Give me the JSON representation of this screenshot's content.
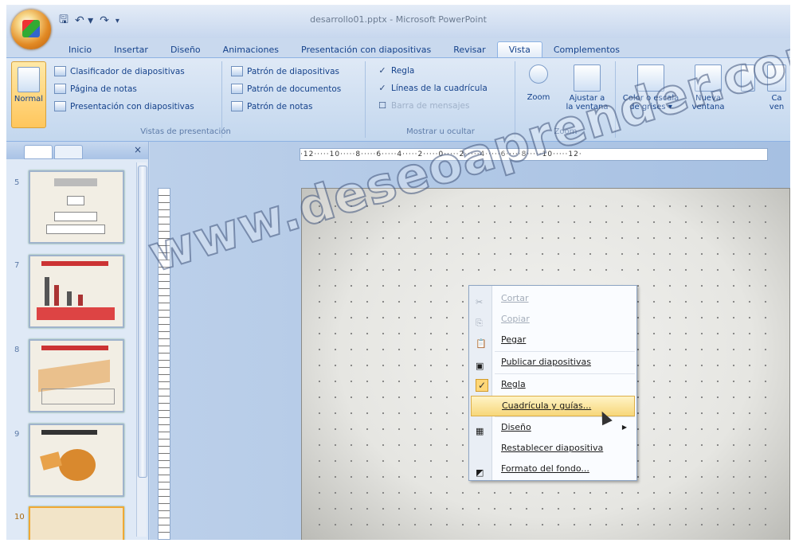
{
  "window": {
    "title": "desarrollo01.pptx - Microsoft PowerPoint"
  },
  "tabs": [
    "Inicio",
    "Insertar",
    "Diseño",
    "Animaciones",
    "Presentación con diapositivas",
    "Revisar",
    "Vista",
    "Complementos"
  ],
  "active_tab": "Vista",
  "ribbon": {
    "group1": {
      "normal": "Normal",
      "items": [
        "Clasificador de diapositivas",
        "Página de notas",
        "Presentación con diapositivas"
      ],
      "patterns": [
        "Patrón de diapositivas",
        "Patrón de documentos",
        "Patrón de notas"
      ],
      "label": "Vistas de presentación"
    },
    "group2": {
      "items": [
        "Regla",
        "Líneas de la cuadrícula",
        "Barra de mensajes"
      ],
      "label": "Mostrar u ocultar"
    },
    "group3": {
      "zoom": "Zoom",
      "fit1": "Ajustar a",
      "fit2": "la ventana",
      "label": "Zoom"
    },
    "group4": {
      "color1": "Color o escala",
      "color2": "de grises",
      "new1": "Nueva",
      "new2": "ventana",
      "cam1": "Ca",
      "cam2": "ven"
    }
  },
  "ruler": {
    "text": "·12·····10·····8·····6·····4·····2·····0·····2·····4·····6·····8·····10·····12·"
  },
  "slides": {
    "numbers": [
      "5",
      "7",
      "8",
      "9",
      "10"
    ]
  },
  "context_menu": {
    "items": [
      "Cortar",
      "Copiar",
      "Pegar",
      "Publicar diapositivas",
      "Regla",
      "Cuadrícula y guías...",
      "Diseño",
      "Restablecer diapositiva",
      "Formato del fondo..."
    ]
  },
  "watermark": "www.deseoaprender.com"
}
